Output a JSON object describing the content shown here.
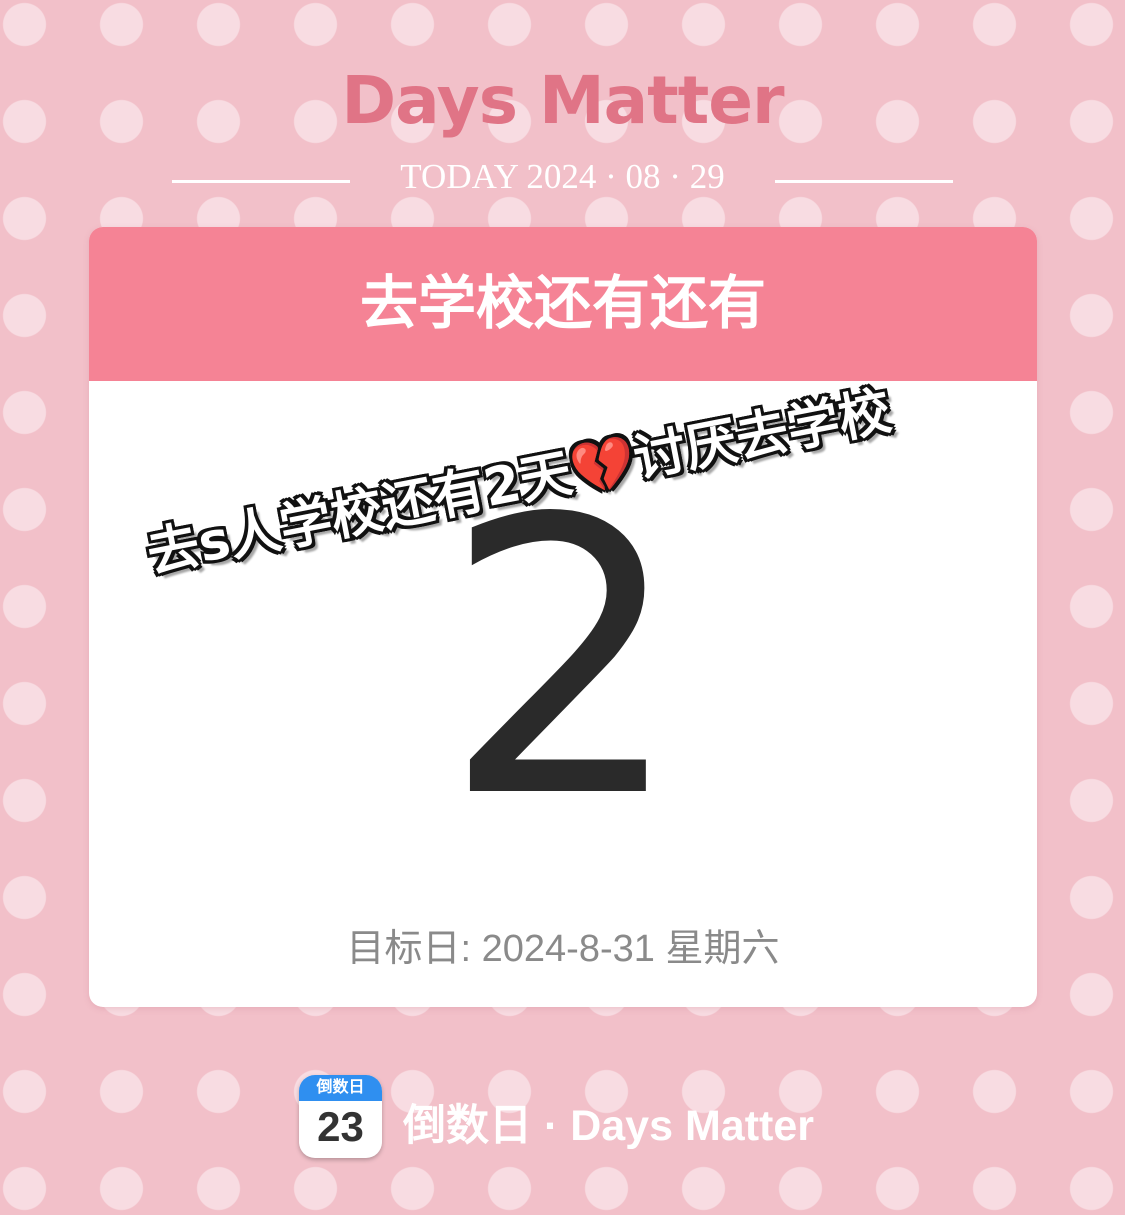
{
  "header": {
    "app_title": "Days Matter",
    "today_text": "TODAY 2024 · 08 · 29"
  },
  "card": {
    "title": "去学校还有还有",
    "count": "2",
    "target_date": "目标日: 2024-8-31 星期六"
  },
  "sticker": {
    "text": "去s人学校还有2天💔讨厌去学校"
  },
  "footer": {
    "icon_label": "倒数日",
    "icon_number": "23",
    "text": "倒数日 · Days Matter"
  },
  "colors": {
    "background": "#f2c0c9",
    "dots": "#f8dce2",
    "title": "#e07486",
    "card_header": "#f58395",
    "number": "#2a2a2a",
    "icon_blue": "#2f8ff0"
  }
}
